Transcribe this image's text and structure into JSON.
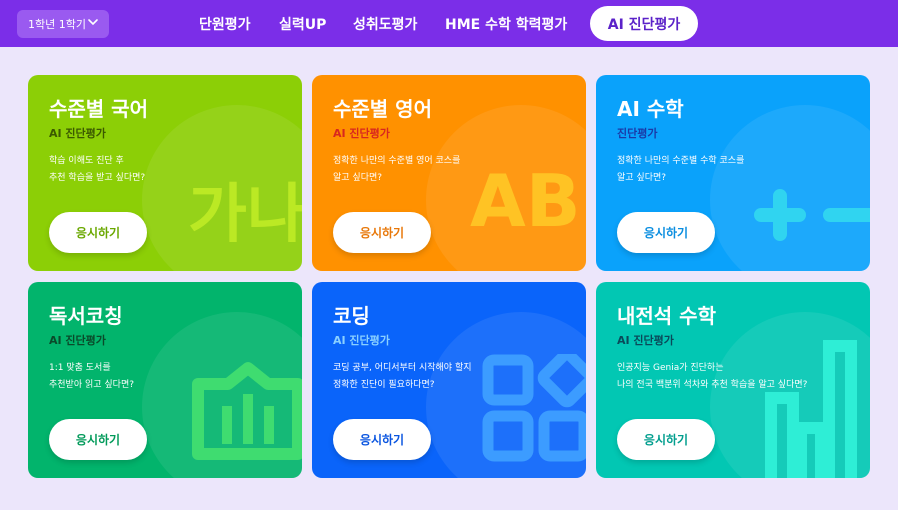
{
  "header": {
    "grade_select": "1학년 1학기",
    "nav": [
      "단원평가",
      "실력UP",
      "성취도평가",
      "HME 수학 학력평가"
    ],
    "nav_active": "AI 진단평가"
  },
  "cards": [
    {
      "title": "수준별 국어",
      "subtitle": "AI 진단평가",
      "desc1": "학습 이해도 진단 후",
      "desc2": "추천 학습을 받고 싶다면?",
      "button": "응시하기",
      "deco_text": "가나",
      "bg": "#8ccf06",
      "subtitle_color": "#3b5a00",
      "button_color": "#6aa800"
    },
    {
      "title": "수준별 영어",
      "subtitle": "AI 진단평가",
      "desc1": "정확한 나만의 수준별 영어 코스를",
      "desc2": "알고 싶다면?",
      "button": "응시하기",
      "deco_text": "AB",
      "bg": "#ff9100",
      "subtitle_color": "#d8271e",
      "button_color": "#e8780a"
    },
    {
      "title": "AI 수학",
      "subtitle": "진단평가",
      "desc1": "정확한 나만의 수준별 수학 코스를",
      "desc2": "알고 싶다면?",
      "button": "응시하기",
      "deco_text": "",
      "bg": "#0aa2fb",
      "subtitle_color": "#1a3aa8",
      "button_color": "#0a8ee0"
    },
    {
      "title": "독서코칭",
      "subtitle": "AI 진단평가",
      "desc1": "1:1 맞춤 도서를",
      "desc2": "추천받아 읽고 싶다면?",
      "button": "응시하기",
      "deco_text": "",
      "bg": "#02b46c",
      "subtitle_color": "#0a4a2a",
      "button_color": "#029a5a"
    },
    {
      "title": "코딩",
      "subtitle": "AI 진단평가",
      "desc1": "코딩 공부, 어디서부터 시작해야 할지",
      "desc2": "정확한 진단이 필요하다면?",
      "button": "응시하기",
      "deco_text": "",
      "bg": "#0a64fa",
      "subtitle_color": "#8ad0ff",
      "button_color": "#0a55e0"
    },
    {
      "title": "내전석 수학",
      "subtitle": "AI 진단평가",
      "desc1": "인공지능 Genia가 진단하는",
      "desc2": "나의 전국 백분위 석차와 추천 학습을 알고 싶다면?",
      "button": "응시하기",
      "deco_text": "",
      "bg": "#02c7b3",
      "subtitle_color": "#0a4a5a",
      "button_color": "#029e8e"
    }
  ],
  "colors": {
    "header_bg": "#7b2ee8",
    "page_bg": "#ece6fb",
    "active_text": "#5b22c9"
  }
}
